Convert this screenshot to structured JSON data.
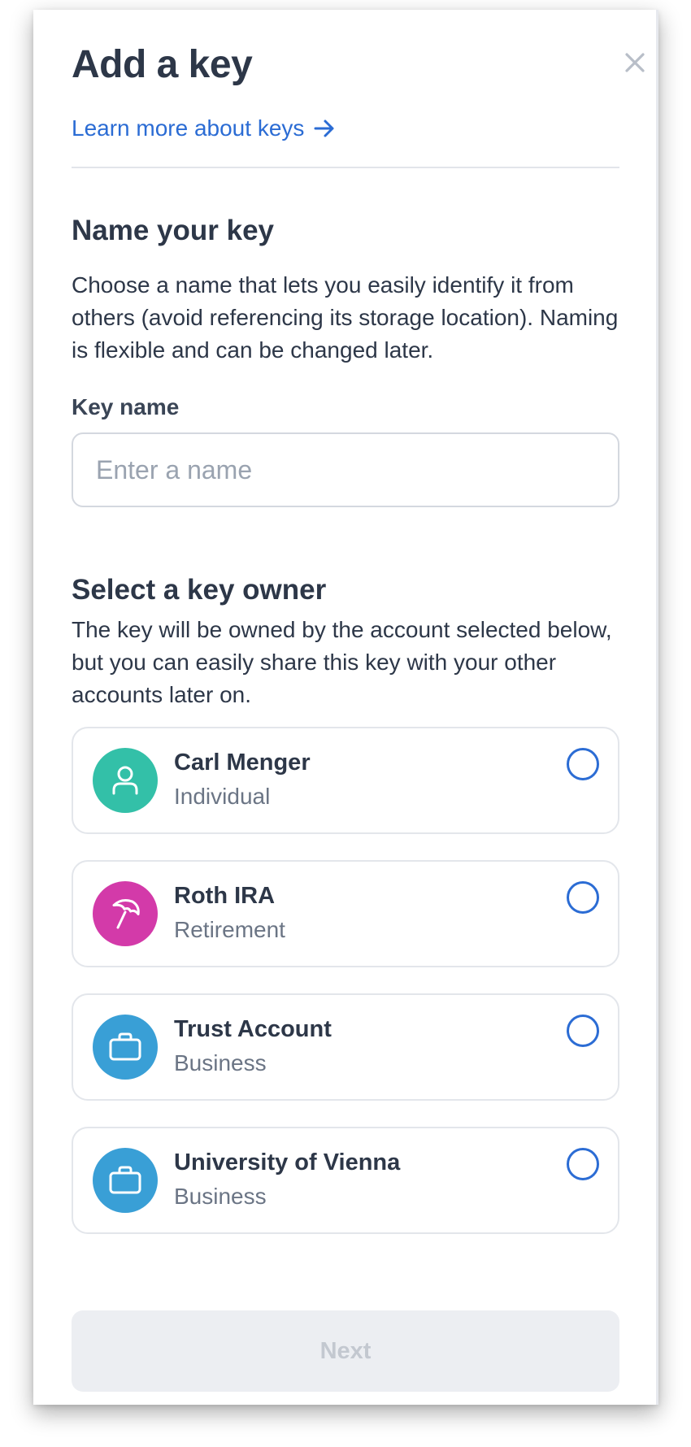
{
  "header": {
    "title": "Add a key",
    "learn_more": "Learn more about keys"
  },
  "name_section": {
    "heading": "Name your key",
    "description": "Choose a name that lets you easily identify it from others (avoid referencing its storage location). Naming is flexible and can be changed later.",
    "field_label": "Key name",
    "field_placeholder": "Enter a name",
    "field_value": ""
  },
  "owner_section": {
    "heading": "Select a key owner",
    "description": "The key will be owned by the account selected below, but you can easily share this key with your other accounts later on.",
    "owners": [
      {
        "name": "Carl Menger",
        "type": "Individual",
        "icon": "person-icon",
        "color": "#33c0a8",
        "selected": false
      },
      {
        "name": "Roth IRA",
        "type": "Retirement",
        "icon": "umbrella-icon",
        "color": "#d33aa9",
        "selected": false
      },
      {
        "name": "Trust Account",
        "type": "Business",
        "icon": "briefcase-icon",
        "color": "#399fd6",
        "selected": false
      },
      {
        "name": "University of Vienna",
        "type": "Business",
        "icon": "briefcase-icon",
        "color": "#399fd6",
        "selected": false
      }
    ]
  },
  "footer": {
    "next_label": "Next",
    "next_enabled": false
  },
  "colors": {
    "accent": "#2b6cd4",
    "text": "#2d3748",
    "muted": "#6b7585"
  }
}
